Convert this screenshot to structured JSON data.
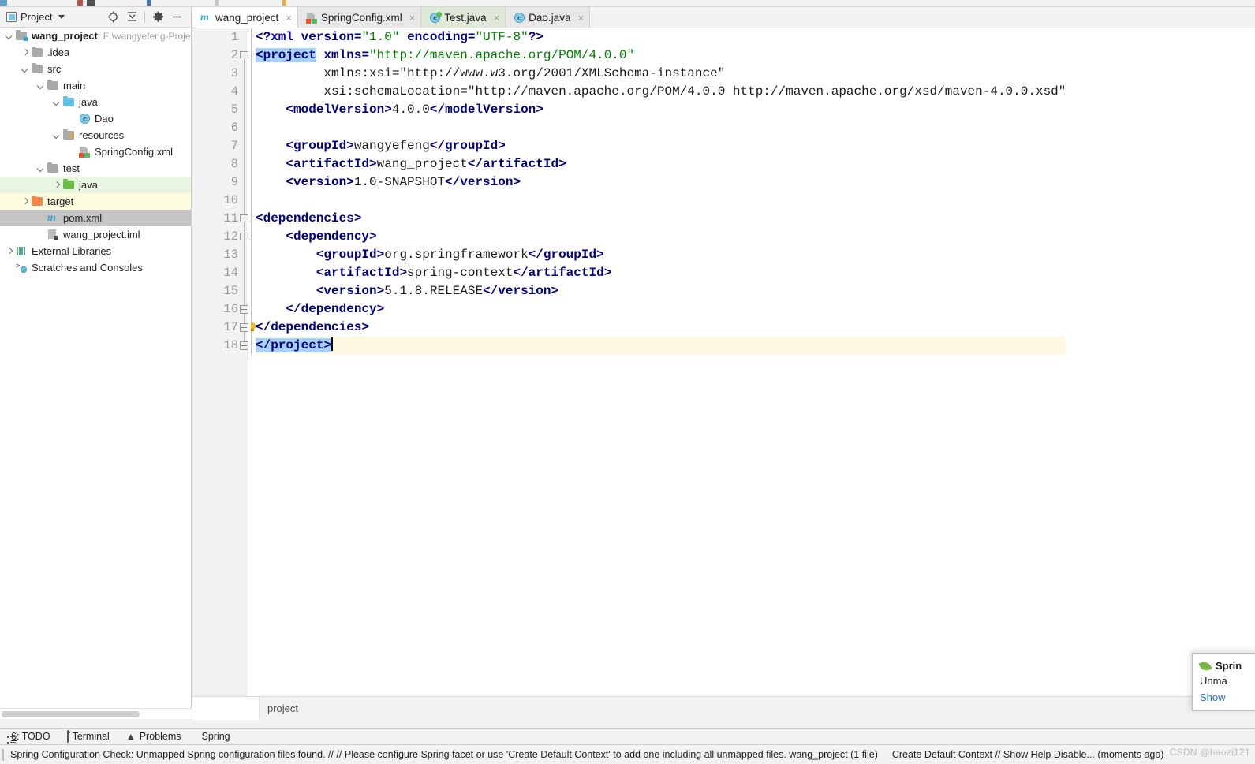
{
  "project_panel": {
    "title": "Project",
    "tools": [
      "locate-icon",
      "collapse-all-icon",
      "settings-icon",
      "hide-icon"
    ],
    "tree": [
      {
        "label": "wang_project",
        "path": "F:\\wangyefeng-Proje",
        "icon": "module-folder",
        "depth": 0,
        "arrow": "down",
        "bold": true,
        "state": "none"
      },
      {
        "label": ".idea",
        "path": "",
        "icon": "folder",
        "depth": 1,
        "arrow": "right",
        "bold": false,
        "state": "none"
      },
      {
        "label": "src",
        "path": "",
        "icon": "folder",
        "depth": 1,
        "arrow": "down",
        "bold": false,
        "state": "none"
      },
      {
        "label": "main",
        "path": "",
        "icon": "folder",
        "depth": 2,
        "arrow": "down",
        "bold": false,
        "state": "none"
      },
      {
        "label": "java",
        "path": "",
        "icon": "folder-source-blue",
        "depth": 3,
        "arrow": "down",
        "bold": false,
        "state": "none"
      },
      {
        "label": "Dao",
        "path": "",
        "icon": "class-icon",
        "depth": 4,
        "arrow": "none",
        "bold": false,
        "state": "none"
      },
      {
        "label": "resources",
        "path": "",
        "icon": "folder-resources",
        "depth": 3,
        "arrow": "down",
        "bold": false,
        "state": "none"
      },
      {
        "label": "SpringConfig.xml",
        "path": "",
        "icon": "spring-xml-icon",
        "depth": 4,
        "arrow": "none",
        "bold": false,
        "state": "none"
      },
      {
        "label": "test",
        "path": "",
        "icon": "folder",
        "depth": 2,
        "arrow": "down",
        "bold": false,
        "state": "none"
      },
      {
        "label": "java",
        "path": "",
        "icon": "folder-test-green",
        "depth": 3,
        "arrow": "right",
        "bold": false,
        "state": "green"
      },
      {
        "label": "target",
        "path": "",
        "icon": "folder-excluded-orange",
        "depth": 1,
        "arrow": "right",
        "bold": false,
        "state": "yellow"
      },
      {
        "label": "pom.xml",
        "path": "",
        "icon": "maven-icon",
        "depth": 2,
        "arrow": "none",
        "bold": false,
        "state": "selected"
      },
      {
        "label": "wang_project.iml",
        "path": "",
        "icon": "iml-icon",
        "depth": 2,
        "arrow": "none",
        "bold": false,
        "state": "none"
      },
      {
        "label": "External Libraries",
        "path": "",
        "icon": "library-icon",
        "depth": 0,
        "arrow": "right",
        "bold": false,
        "state": "none"
      },
      {
        "label": "Scratches and Consoles",
        "path": "",
        "icon": "scratches-icon",
        "depth": 0,
        "arrow": "none",
        "bold": false,
        "state": "none"
      }
    ]
  },
  "editor": {
    "tabs": [
      {
        "label": "wang_project",
        "icon": "maven-icon",
        "active": true,
        "scope": "normal"
      },
      {
        "label": "SpringConfig.xml",
        "icon": "spring-xml-icon",
        "active": false,
        "scope": "normal"
      },
      {
        "label": "Test.java",
        "icon": "class-test-icon",
        "active": false,
        "scope": "test"
      },
      {
        "label": "Dao.java",
        "icon": "class-icon",
        "active": false,
        "scope": "normal"
      }
    ],
    "close_glyph": "×",
    "line_count": 18,
    "current_line": 18,
    "breadcrumb": "project",
    "lines": [
      {
        "n": 1,
        "text": "<?xml version=\"1.0\" encoding=\"UTF-8\"?>"
      },
      {
        "n": 2,
        "text": "<project xmlns=\"http://maven.apache.org/POM/4.0.0\""
      },
      {
        "n": 3,
        "text": "         xmlns:xsi=\"http://www.w3.org/2001/XMLSchema-instance\""
      },
      {
        "n": 4,
        "text": "         xsi:schemaLocation=\"http://maven.apache.org/POM/4.0.0 http://maven.apache.org/xsd/maven-4.0.0.xsd\""
      },
      {
        "n": 5,
        "text": "    <modelVersion>4.0.0</modelVersion>"
      },
      {
        "n": 6,
        "text": ""
      },
      {
        "n": 7,
        "text": "    <groupId>wangyefeng</groupId>"
      },
      {
        "n": 8,
        "text": "    <artifactId>wang_project</artifactId>"
      },
      {
        "n": 9,
        "text": "    <version>1.0-SNAPSHOT</version>"
      },
      {
        "n": 10,
        "text": ""
      },
      {
        "n": 11,
        "text": "<dependencies>"
      },
      {
        "n": 12,
        "text": "    <dependency>"
      },
      {
        "n": 13,
        "text": "        <groupId>org.springframework</groupId>"
      },
      {
        "n": 14,
        "text": "        <artifactId>spring-context</artifactId>"
      },
      {
        "n": 15,
        "text": "        <version>5.1.8.RELEASE</version>"
      },
      {
        "n": 16,
        "text": "    </dependency>"
      },
      {
        "n": 17,
        "text": "</dependencies>"
      },
      {
        "n": 18,
        "text": "</project>"
      }
    ]
  },
  "notification": {
    "title": "Sprin",
    "body": "Unma",
    "link": "Show"
  },
  "tool_window_bar": {
    "items": [
      {
        "label": "6: TODO",
        "mnemonic": "6",
        "icon": "todo-icon"
      },
      {
        "label": "Terminal",
        "icon": "terminal-icon"
      },
      {
        "label": "Problems",
        "icon": "warning-icon"
      },
      {
        "label": "Spring",
        "icon": "spring-leaf-icon"
      }
    ]
  },
  "status_bar": {
    "message": "Spring Configuration Check: Unmapped Spring configuration files found. // // Please configure Spring facet or use 'Create Default Context' to add one including all unmapped files. wang_project (1 file)",
    "action": "Create Default Context // Show Help Disable... (moments ago)",
    "watermark": "CSDN @haozi121"
  },
  "colors": {
    "tag": "#000080",
    "attribute_value": "#008000",
    "namespace": "#7a2a5a",
    "selection": "#a6d2ff",
    "current_line": "#fdf8e2",
    "tree_selected": "#c4c4c4",
    "tree_test_green": "#e8f5e0",
    "tree_excluded_yellow": "#fdfbe0",
    "link": "#2a6fc9"
  }
}
